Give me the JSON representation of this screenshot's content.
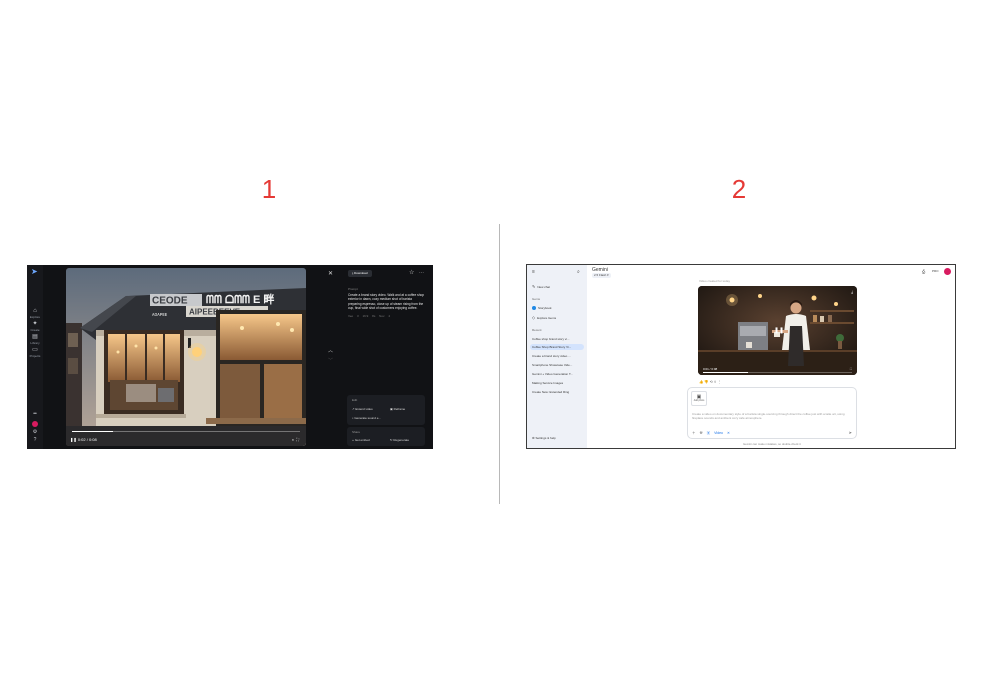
{
  "labels": {
    "panel1": "1",
    "panel2": "2"
  },
  "panel1": {
    "nav": [
      {
        "icon": "home-icon",
        "glyph": "⌂",
        "label": "Explore"
      },
      {
        "icon": "create-icon",
        "glyph": "✦",
        "label": "Create"
      },
      {
        "icon": "library-icon",
        "glyph": "▤",
        "label": "Library"
      },
      {
        "icon": "folder-icon",
        "glyph": "▭",
        "label": "Projects"
      }
    ],
    "video": {
      "sign_top": "CEODE",
      "sign_mid": "ᗰᗰ ᗝᗰᗰ E 畔",
      "sign_right": "AIPEEBEEVE",
      "sign_small": "ᴀᴏᴀᴘᴇᴇ",
      "time": "0:02 / 0:08"
    },
    "download_label": "Download",
    "prompt_label": "Prompt",
    "prompt": "Create a brand story video. Walk and at a coffee shop exterior in dawn, cozy medium shot of barista preparing espresso, close up of steam rising from the cup, final wide shot of customers enjoying coffee.",
    "meta": "Veo 3   16:9   8s   Nov 4",
    "edit_title": "Edit",
    "edit_actions": [
      "Extend video",
      "Reframe",
      "Generate sound e..."
    ],
    "share_title": "Share",
    "share_actions": [
      "Get embed",
      "Regenerate"
    ]
  },
  "panel2": {
    "app_title": "Gemini",
    "model": "2.5 Flash ▾",
    "pro_label": "PRO",
    "new_chat": "New chat",
    "explore_gems": "Explore Gems",
    "gems_label": "Gems",
    "gem_item": "Storybook",
    "recent_label": "Recent",
    "recent": [
      "Coffee shop brand story vi...",
      "Coffee Shop Brand Story Vi...",
      "Create a brand story video ...",
      "Smartphone Showcase Vide...",
      "Gemini + Video Generation T...",
      "Making Service Images",
      "Create New: Extended Ring"
    ],
    "settings": "Settings & help",
    "faded_text": "Video created for today",
    "video_time": "0:01 / 0:08",
    "attachment_label": "Add photo",
    "input_placeholder": "Create a video on documentary style of a barista single-sourcing through direct the coffee just with a latte art, using fireplace sounds and ambient cozy cafe atmosphere.",
    "video_chip": "Video",
    "disclaimer": "Gemini can make mistakes, so double-check it"
  }
}
